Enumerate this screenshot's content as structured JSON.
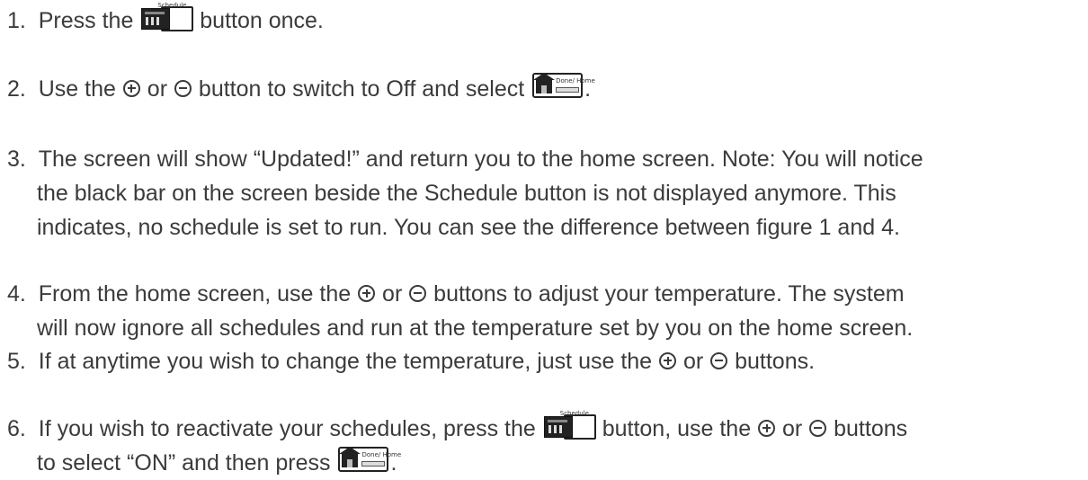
{
  "steps": [
    {
      "num": "1.",
      "lines": [
        [
          "Press the ",
          "{schedule}",
          " button once."
        ]
      ]
    },
    {
      "num": "2.",
      "lines": [
        [
          "Use the ",
          "{plus}",
          " or ",
          "{minus}",
          " button to switch to Off and select ",
          "{home}",
          "."
        ]
      ]
    },
    {
      "num": "3.",
      "lines": [
        [
          "The screen will show “Updated!” and return you to the home screen. Note: You will notice"
        ],
        [
          "the black bar on the screen beside the Schedule button is not displayed anymore. This"
        ],
        [
          "indicates, no schedule is set to run. You can see the difference between figure 1 and 4."
        ]
      ]
    },
    {
      "num": "4.",
      "lines": [
        [
          "From the home screen, use the ",
          "{plus}",
          " or ",
          "{minus}",
          " buttons to adjust your temperature. The system"
        ],
        [
          "will now ignore all schedules and run at the temperature set by you on the home screen."
        ]
      ]
    },
    {
      "num": "5.",
      "lines": [
        [
          "If at anytime you wish to change the temperature, just use the ",
          "{plus}",
          " or ",
          "{minus}",
          " buttons."
        ]
      ]
    },
    {
      "num": "6.",
      "lines": [
        [
          "If you wish to reactivate your schedules, press the ",
          "{schedule}",
          " button, use the ",
          "{plus}",
          " or ",
          "{minus}",
          " buttons"
        ],
        [
          "to select “ON” and then press ",
          "{home}",
          "."
        ]
      ]
    }
  ],
  "icons": {
    "schedule": {
      "name": "schedule-button-icon",
      "tag": "Schedule"
    },
    "home": {
      "name": "home-done-button-icon",
      "text": "Done/ Home"
    },
    "plus": {
      "name": "plus-circle-icon"
    },
    "minus": {
      "name": "minus-circle-icon"
    }
  },
  "colors": {
    "text": "#3b3b3b",
    "icon": "#222222"
  }
}
